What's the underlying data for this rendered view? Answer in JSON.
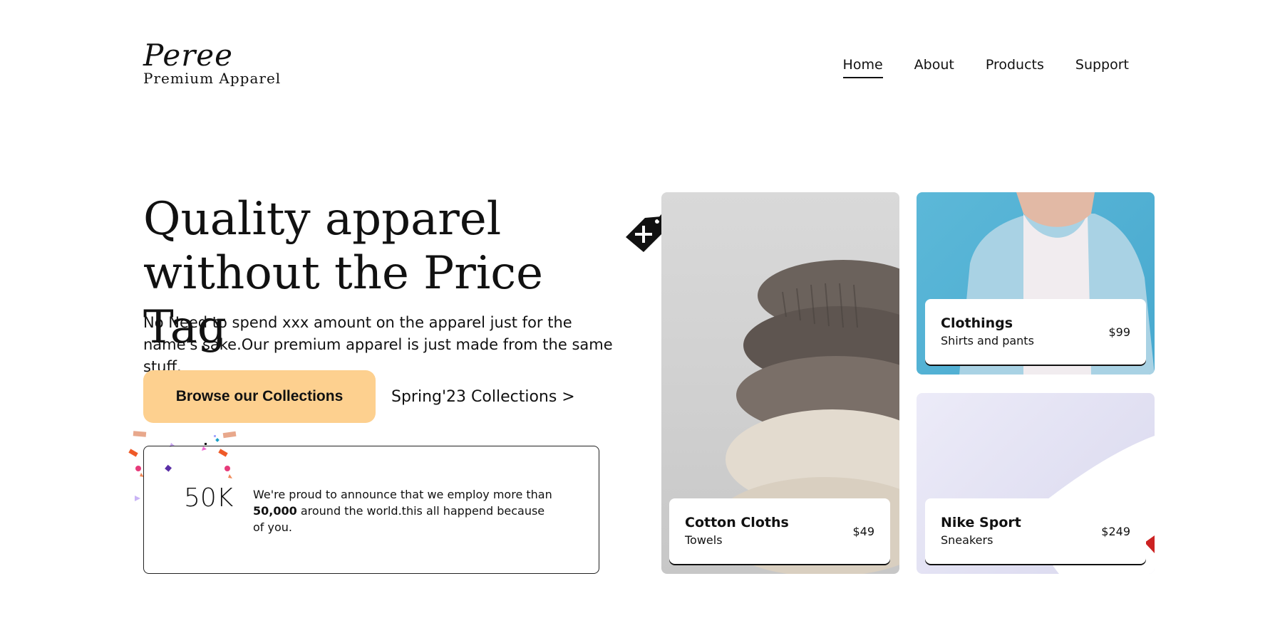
{
  "brand": {
    "name": "Peree",
    "tagline": "Premium Apparel"
  },
  "nav": {
    "items": [
      "Home",
      "About",
      "Products",
      "Support"
    ],
    "active": "Home"
  },
  "hero": {
    "headline": "Quality apparel without the Price Tag",
    "subtext": "No Need to spend xxx amount on the apparel just for the name's sake.Our premium apparel is just made from the same stuff.",
    "cta_label": "Browse our Collections",
    "secondary_link": "Spring'23 Collections >"
  },
  "stat": {
    "number": "50K",
    "text_before": "We're proud to announce that we employ more than ",
    "text_bold": "50,000",
    "text_after": " around the world.this all happend because of you."
  },
  "products": [
    {
      "title": "Cotton Cloths",
      "subtitle": "Towels",
      "price": "$49"
    },
    {
      "title": "Clothings",
      "subtitle": "Shirts and pants",
      "price": "$99"
    },
    {
      "title": "Nike Sport",
      "subtitle": "Sneakers",
      "price": "$249"
    }
  ],
  "colors": {
    "cta_background": "#fdd08f",
    "text": "#111111",
    "denim_background": "#4aaad0",
    "shoe_background": "#e6e5f5"
  },
  "icons": {
    "price_tag": "price-tag-icon"
  }
}
